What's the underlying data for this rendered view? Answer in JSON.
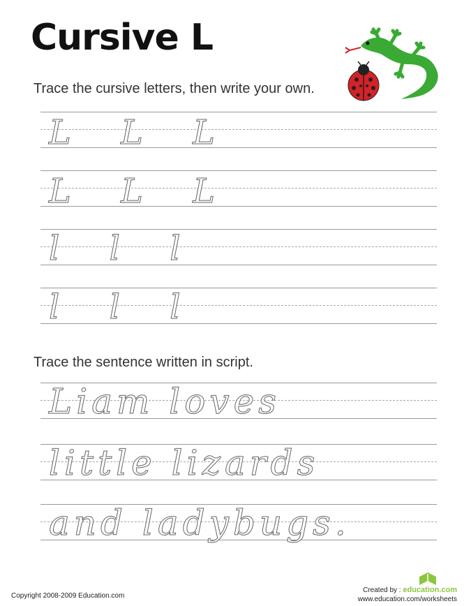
{
  "worksheet": {
    "title": "Cursive L",
    "instruction_letters": "Trace the cursive letters, then write your own.",
    "instruction_sentence": "Trace the sentence written in script."
  },
  "letter_rows": [
    "L L L",
    "L L L",
    "l l l",
    "l l l"
  ],
  "sentence_rows": [
    "Liam loves",
    "little lizards",
    "and ladybugs."
  ],
  "footer": {
    "copyright": "Copyright 2008-2009 Education.com",
    "created_by": "Created by :",
    "brand": "education.com",
    "url": "www.education.com/worksheets"
  },
  "icons": [
    "lizard-icon",
    "ladybug-icon",
    "education-logo-icon"
  ],
  "colors": {
    "lizard": "#3aaa35",
    "ladybug": "#d62128",
    "brand": "#8cc63f"
  }
}
